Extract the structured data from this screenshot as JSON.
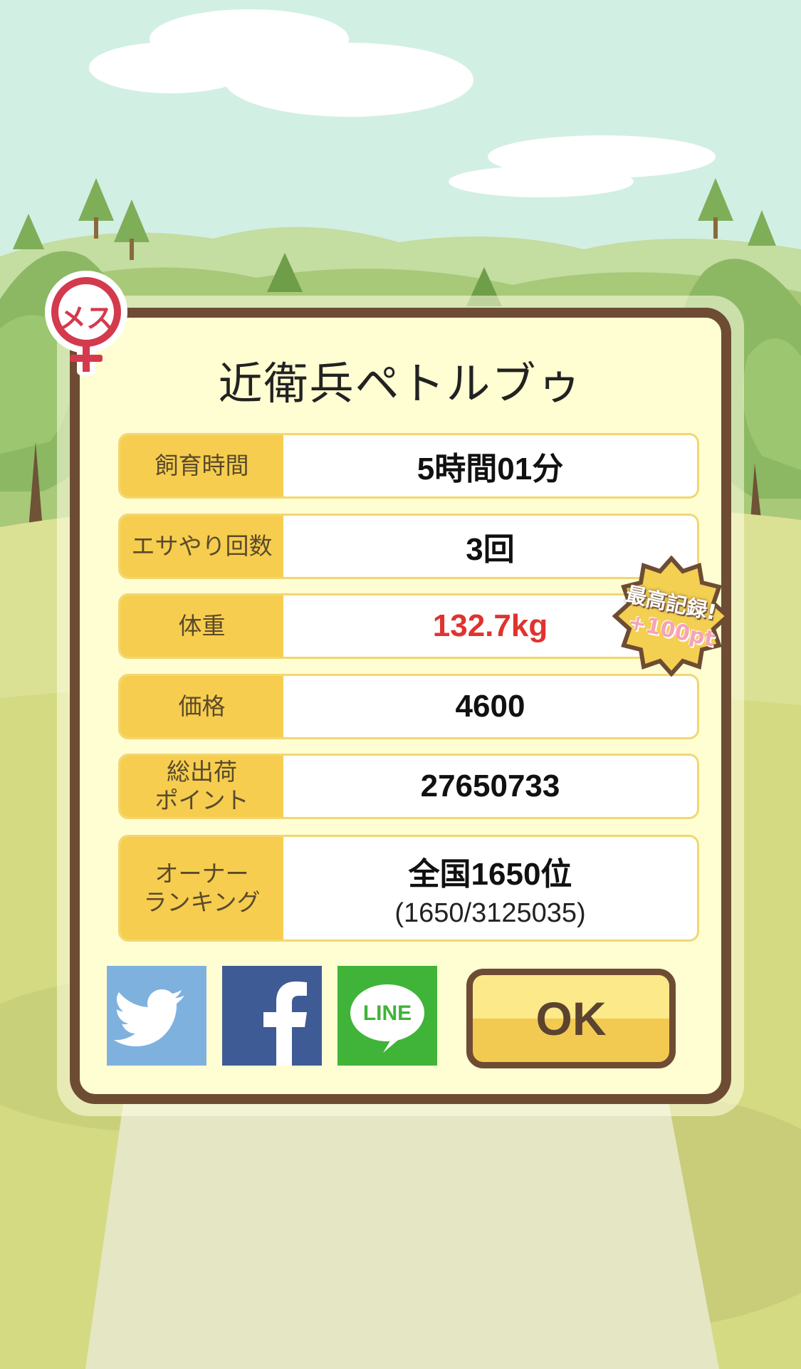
{
  "pet": {
    "gender_label": "メス",
    "name": "近衛兵ペトルブゥ"
  },
  "stats": [
    {
      "label": "飼育時間",
      "value": "5時間01分"
    },
    {
      "label": "エサやり回数",
      "value": "3回"
    },
    {
      "label": "体重",
      "value": "132.7kg",
      "highlight_color": "#e0332f"
    },
    {
      "label": "価格",
      "value": "4600"
    },
    {
      "label": "総出荷\nポイント",
      "value": "27650733"
    },
    {
      "label": "オーナー\nランキング",
      "value": "全国1650位",
      "sub": "(1650/3125035)"
    }
  ],
  "record_badge": {
    "line1": "最高記録!",
    "line2": "+100pt"
  },
  "share": {
    "twitter_icon": "twitter-bird-icon",
    "facebook_icon": "facebook-f-icon",
    "line_icon": "line-speech-bubble-icon",
    "line_text": "LINE",
    "twitter_color": "#7fb1df",
    "facebook_color": "#3f5b95",
    "line_color": "#3fb438"
  },
  "ok_label": "OK"
}
